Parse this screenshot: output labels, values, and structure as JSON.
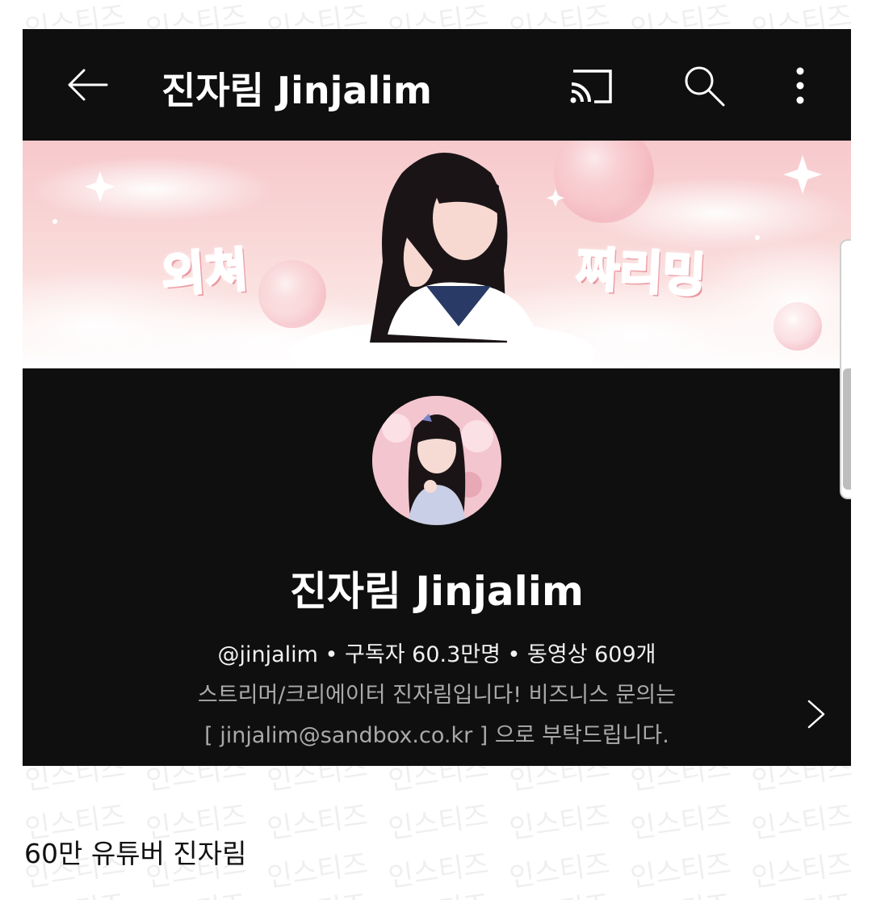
{
  "app_bar": {
    "title": "진자림 Jinjalim",
    "back_icon": "arrow-left-icon",
    "cast_icon": "cast-icon",
    "search_icon": "search-icon",
    "more_icon": "more-vertical-icon"
  },
  "banner": {
    "left_text": "외쳐",
    "right_text": "짜리밍",
    "accent_color": "#f4a0a8"
  },
  "channel": {
    "name": "진자림 Jinjalim",
    "meta": "@jinjalim • 구독자 60.3만명 • 동영상 609개",
    "description_line1": "스트리머/크리에이터 진자림입니다! 비즈니스 문의는",
    "description_line2": "[ jinjalim@sandbox.co.kr ] 으로 부탁드립니다.",
    "more_icon": "chevron-right-icon"
  },
  "caption": "60만 유튜버 진자림",
  "watermark": "인스티즈"
}
